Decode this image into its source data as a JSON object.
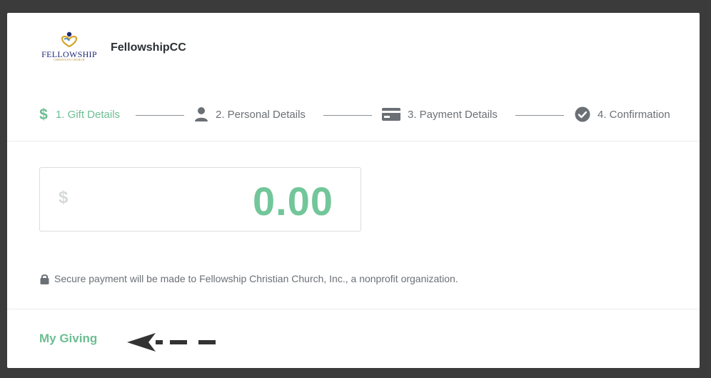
{
  "header": {
    "logo_text": "FELLOWSHIP",
    "logo_sub": "CHRISTIAN CHURCH",
    "org_name": "FellowshipCC"
  },
  "steps": [
    {
      "label": "1. Gift Details",
      "icon": "dollar-icon",
      "active": true
    },
    {
      "label": "2. Personal Details",
      "icon": "person-icon",
      "active": false
    },
    {
      "label": "3. Payment Details",
      "icon": "credit-card-icon",
      "active": false
    },
    {
      "label": "4. Confirmation",
      "icon": "check-circle-icon",
      "active": false
    }
  ],
  "amount": {
    "currency_symbol": "$",
    "value": "0.00"
  },
  "secure_notice": "Secure payment will be made to Fellowship Christian Church, Inc., a nonprofit organization.",
  "footer": {
    "my_giving_label": "My Giving"
  },
  "colors": {
    "accent": "#6cbe92",
    "text_muted": "#6b7075",
    "background": "#3b3b3b"
  }
}
